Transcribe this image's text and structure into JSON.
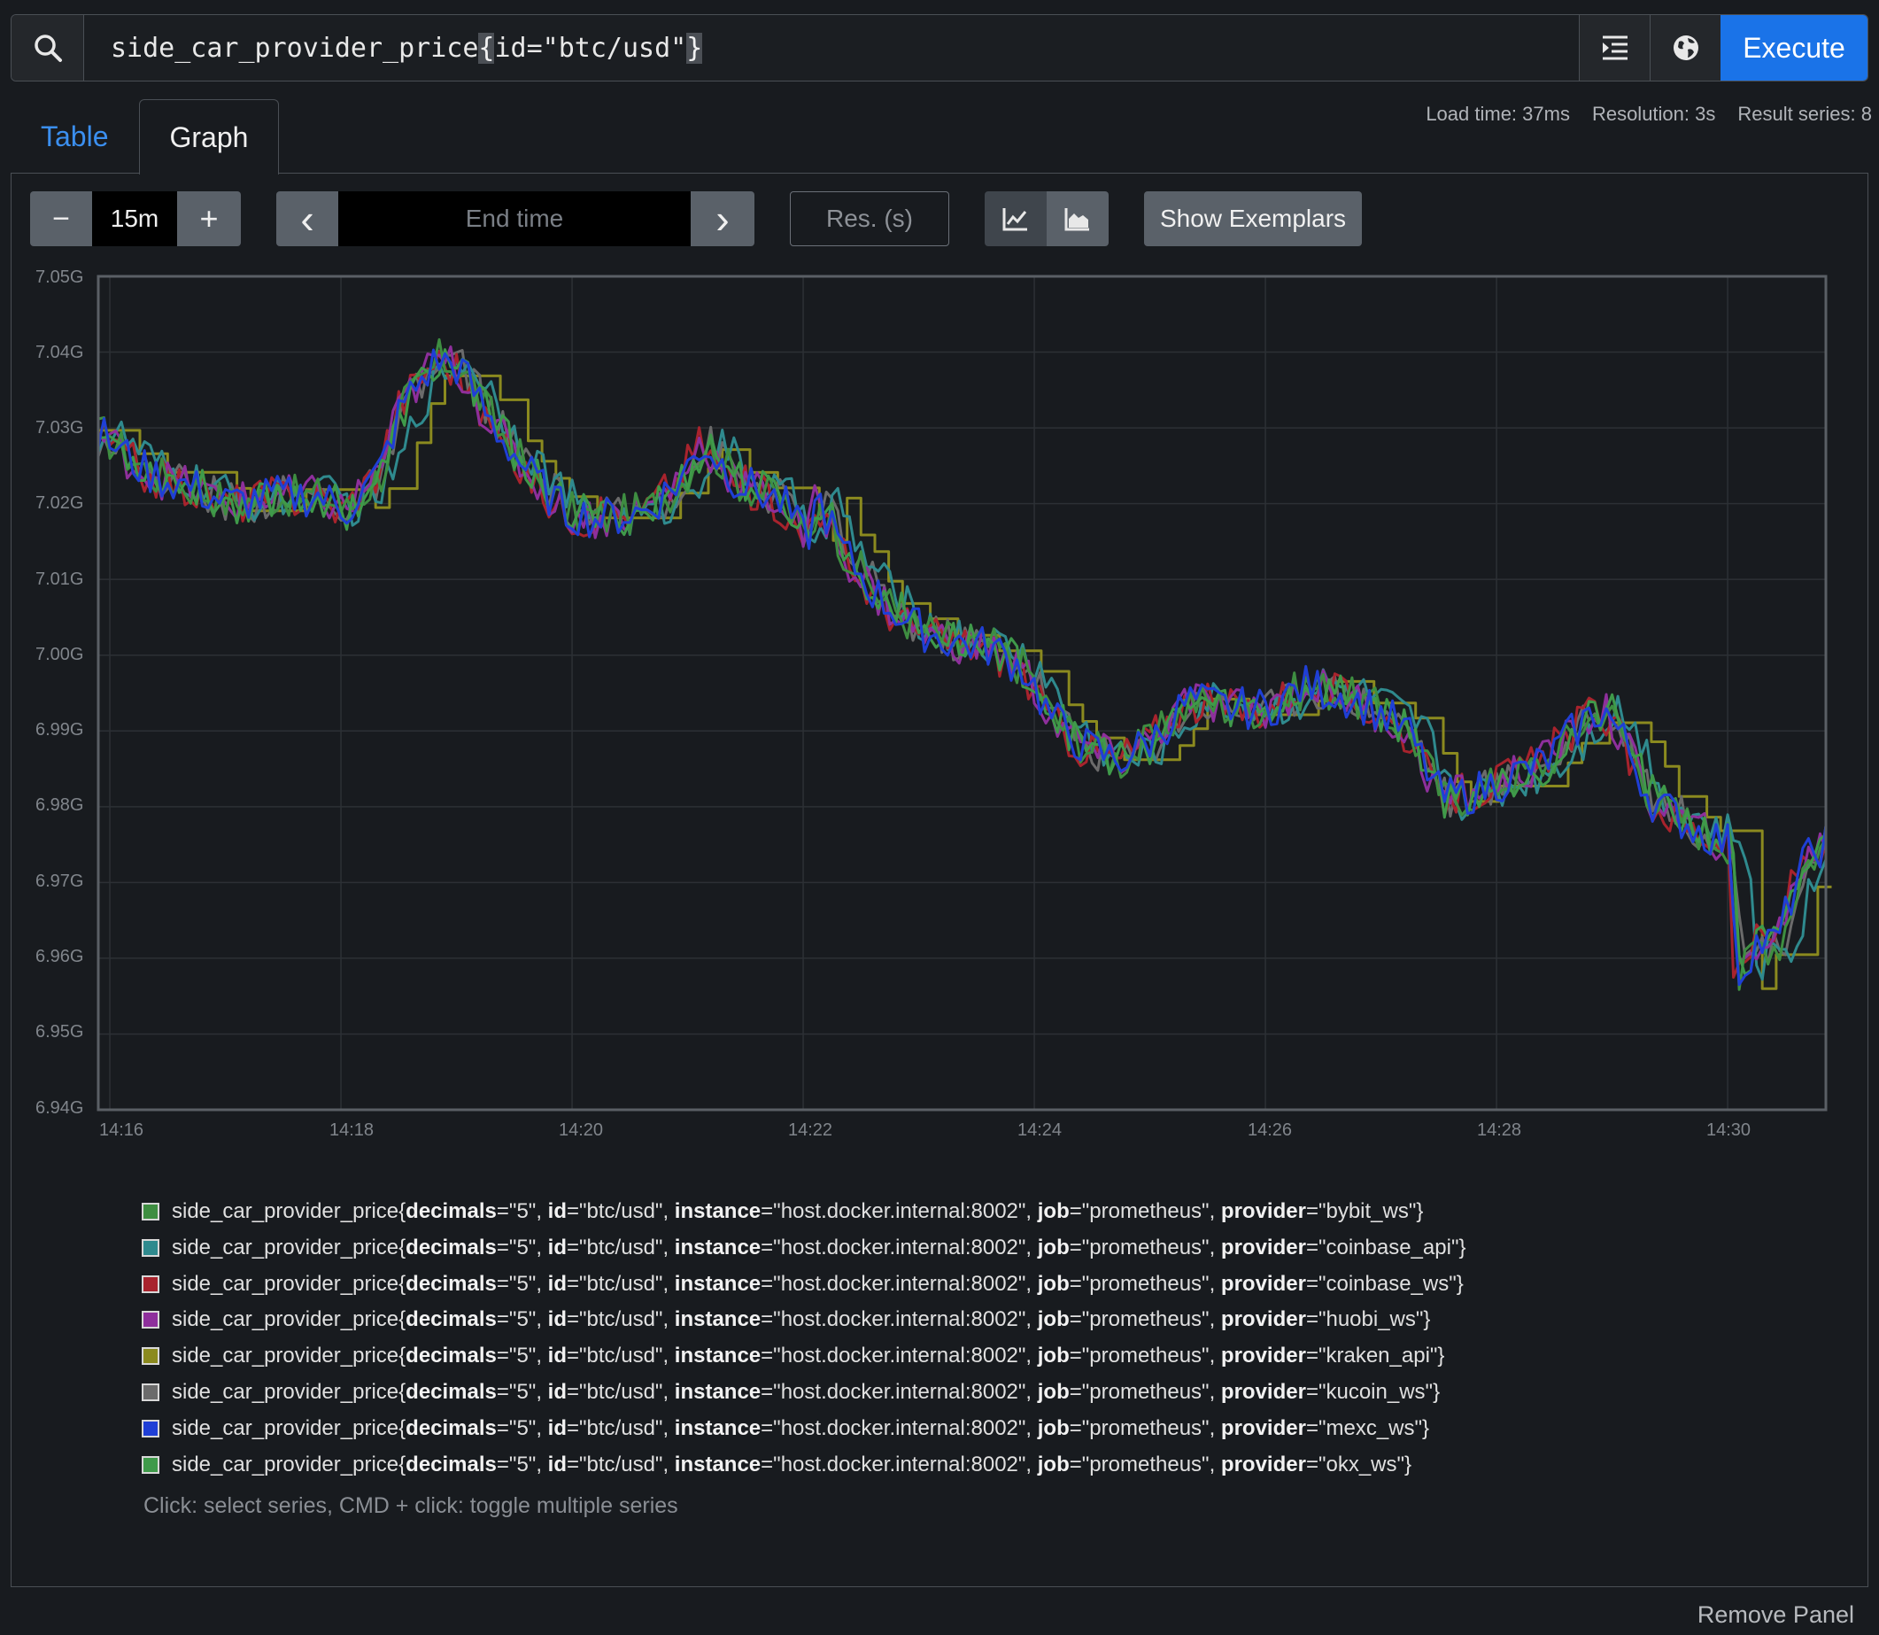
{
  "query": {
    "expression_prefix": "side_car_provider_price",
    "open_brace": "{",
    "matcher": "id=\"btc/usd\"",
    "close_brace": "}",
    "execute_label": "Execute",
    "icons": [
      "search-icon",
      "format-expression-icon",
      "metrics-explorer-icon"
    ]
  },
  "stats": {
    "load_time": "Load time: 37ms",
    "resolution": "Resolution: 3s",
    "result_series": "Result series: 8"
  },
  "tabs": [
    {
      "label": "Table",
      "active": false
    },
    {
      "label": "Graph",
      "active": true
    }
  ],
  "controls": {
    "range_minus": "−",
    "range_value": "15m",
    "range_plus": "+",
    "end_time_prev": "‹",
    "end_time_placeholder": "End time",
    "end_time_next": "›",
    "resolution_placeholder": "Res. (s)",
    "chart_mode_icons": [
      "line-chart-icon",
      "stacked-area-chart-icon"
    ],
    "show_exemplars": "Show Exemplars"
  },
  "chart_data": {
    "type": "line",
    "y_ticks": [
      "7.05G",
      "7.04G",
      "7.03G",
      "7.02G",
      "7.01G",
      "7.00G",
      "6.99G",
      "6.98G",
      "6.97G",
      "6.96G",
      "6.95G",
      "6.94G"
    ],
    "ylim": [
      6.94,
      7.05
    ],
    "x_ticks": [
      "14:16",
      "14:18",
      "14:20",
      "14:22",
      "14:24",
      "14:26",
      "14:28",
      "14:30"
    ],
    "xlim_minutes": [
      15.9,
      30.85
    ],
    "grid": true,
    "base_curve": [
      [
        15.9,
        7.029
      ],
      [
        16.3,
        7.024
      ],
      [
        16.7,
        7.022
      ],
      [
        17.0,
        7.02
      ],
      [
        17.4,
        7.021
      ],
      [
        17.8,
        7.021
      ],
      [
        18.0,
        7.019
      ],
      [
        18.3,
        7.024
      ],
      [
        18.5,
        7.033
      ],
      [
        18.8,
        7.039
      ],
      [
        19.0,
        7.038
      ],
      [
        19.3,
        7.03
      ],
      [
        19.6,
        7.024
      ],
      [
        19.9,
        7.019
      ],
      [
        20.2,
        7.018
      ],
      [
        20.6,
        7.019
      ],
      [
        20.9,
        7.023
      ],
      [
        21.1,
        7.028
      ],
      [
        21.4,
        7.023
      ],
      [
        21.8,
        7.02
      ],
      [
        22.0,
        7.015
      ],
      [
        22.1,
        7.021
      ],
      [
        22.3,
        7.014
      ],
      [
        22.6,
        7.008
      ],
      [
        22.9,
        7.004
      ],
      [
        23.2,
        7.002
      ],
      [
        23.6,
        7.001
      ],
      [
        23.9,
        6.998
      ],
      [
        24.1,
        6.992
      ],
      [
        24.4,
        6.988
      ],
      [
        24.7,
        6.986
      ],
      [
        25.0,
        6.989
      ],
      [
        25.3,
        6.994
      ],
      [
        25.7,
        6.993
      ],
      [
        26.0,
        6.993
      ],
      [
        26.3,
        6.996
      ],
      [
        26.6,
        6.995
      ],
      [
        26.9,
        6.993
      ],
      [
        27.2,
        6.99
      ],
      [
        27.5,
        6.981
      ],
      [
        27.8,
        6.982
      ],
      [
        28.1,
        6.984
      ],
      [
        28.4,
        6.986
      ],
      [
        28.7,
        6.991
      ],
      [
        28.9,
        6.993
      ],
      [
        29.1,
        6.988
      ],
      [
        29.3,
        6.981
      ],
      [
        29.7,
        6.977
      ],
      [
        30.0,
        6.975
      ],
      [
        30.05,
        6.957
      ],
      [
        30.2,
        6.962
      ],
      [
        30.4,
        6.962
      ],
      [
        30.6,
        6.972
      ],
      [
        30.85,
        6.976
      ]
    ],
    "series": [
      {
        "name": "side_car_provider_price{decimals=\"5\", id=\"btc/usd\", instance=\"host.docker.internal:8002\", job=\"prometheus\", provider=\"bybit_ws\"}",
        "color": "#3e8e41"
      },
      {
        "name": "side_car_provider_price{decimals=\"5\", id=\"btc/usd\", instance=\"host.docker.internal:8002\", job=\"prometheus\", provider=\"coinbase_api\"}",
        "color": "#2f8a8e"
      },
      {
        "name": "side_car_provider_price{decimals=\"5\", id=\"btc/usd\", instance=\"host.docker.internal:8002\", job=\"prometheus\", provider=\"coinbase_ws\"}",
        "color": "#a8232d"
      },
      {
        "name": "side_car_provider_price{decimals=\"5\", id=\"btc/usd\", instance=\"host.docker.internal:8002\", job=\"prometheus\", provider=\"huobi_ws\"}",
        "color": "#8e2f9c"
      },
      {
        "name": "side_car_provider_price{decimals=\"5\", id=\"btc/usd\", instance=\"host.docker.internal:8002\", job=\"prometheus\", provider=\"kraken_api\"}",
        "color": "#8b8a1f"
      },
      {
        "name": "side_car_provider_price{decimals=\"5\", id=\"btc/usd\", instance=\"host.docker.internal:8002\", job=\"prometheus\", provider=\"kucoin_ws\"}",
        "color": "#6b6b6b"
      },
      {
        "name": "side_car_provider_price{decimals=\"5\", id=\"btc/usd\", instance=\"host.docker.internal:8002\", job=\"prometheus\", provider=\"mexc_ws\"}",
        "color": "#1f3fd6"
      },
      {
        "name": "side_car_provider_price{decimals=\"5\", id=\"btc/usd\", instance=\"host.docker.internal:8002\", job=\"prometheus\", provider=\"okx_ws\"}",
        "color": "#3f9a4a"
      }
    ]
  },
  "legend": {
    "metric": "side_car_provider_price",
    "decimals": "5",
    "id": "btc/usd",
    "instance": "host.docker.internal:8002",
    "job": "prometheus",
    "providers": [
      "bybit_ws",
      "coinbase_api",
      "coinbase_ws",
      "huobi_ws",
      "kraken_api",
      "kucoin_ws",
      "mexc_ws",
      "okx_ws"
    ],
    "colors": [
      "#3e8e41",
      "#2f8a8e",
      "#a8232d",
      "#8e2f9c",
      "#8b8a1f",
      "#6b6b6b",
      "#1f3fd6",
      "#3f9a4a"
    ],
    "hint": "Click: select series, CMD + click: toggle multiple series"
  },
  "footer": {
    "remove_panel": "Remove Panel"
  }
}
